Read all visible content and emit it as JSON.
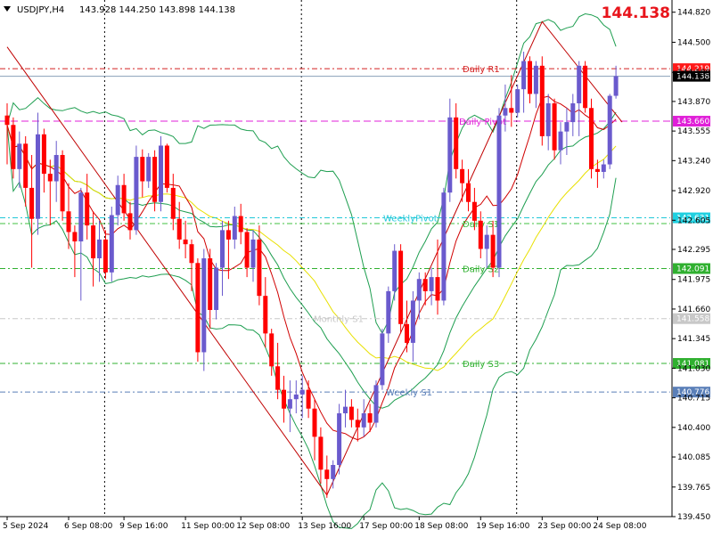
{
  "header": {
    "symbol": "USDJPY,H4",
    "ohlc": "143.928 144.250 143.898 144.138",
    "last_price": "144.138",
    "colors": {
      "last_price": "#e8141b"
    }
  },
  "chart_data": {
    "type": "candlestick",
    "title": "USDJPY,H4",
    "ylim": [
      139.45,
      144.95
    ],
    "y_ticks": [
      "144.820",
      "144.500",
      "144.180",
      "143.870",
      "143.555",
      "143.240",
      "142.920",
      "142.605",
      "142.295",
      "141.975",
      "141.660",
      "141.345",
      "141.030",
      "140.715",
      "140.400",
      "140.085",
      "139.765",
      "139.450"
    ],
    "x_ticks": [
      "5 Sep 2024",
      "6 Sep 08:00",
      "9 Sep 16:00",
      "11 Sep 00:00",
      "12 Sep 08:00",
      "13 Sep 16:00",
      "17 Sep 00:00",
      "18 Sep 08:00",
      "19 Sep 16:00",
      "23 Sep 00:00",
      "24 Sep 08:00"
    ],
    "grid": false,
    "candles": [
      [
        143.72,
        143.85,
        143.2,
        143.62
      ],
      [
        143.62,
        143.7,
        143.05,
        143.15
      ],
      [
        143.15,
        143.55,
        142.95,
        143.42
      ],
      [
        143.42,
        143.5,
        142.75,
        142.95
      ],
      [
        142.95,
        143.3,
        142.1,
        142.62
      ],
      [
        142.62,
        143.75,
        142.45,
        143.52
      ],
      [
        143.52,
        143.58,
        142.9,
        143.1
      ],
      [
        143.1,
        143.25,
        142.55,
        143.02
      ],
      [
        143.02,
        143.45,
        142.8,
        143.3
      ],
      [
        143.3,
        143.35,
        142.6,
        142.7
      ],
      [
        142.7,
        143.0,
        142.3,
        142.48
      ],
      [
        142.48,
        142.55,
        142.0,
        142.38
      ],
      [
        142.38,
        142.95,
        141.75,
        142.9
      ],
      [
        142.9,
        143.1,
        142.4,
        142.55
      ],
      [
        142.55,
        142.7,
        141.9,
        142.2
      ],
      [
        142.2,
        142.6,
        141.95,
        142.4
      ],
      [
        142.4,
        142.5,
        141.98,
        142.05
      ],
      [
        142.05,
        142.75,
        141.95,
        142.66
      ],
      [
        142.66,
        143.08,
        142.55,
        142.98
      ],
      [
        142.98,
        143.1,
        142.6,
        142.68
      ],
      [
        142.68,
        142.8,
        142.4,
        142.5
      ],
      [
        142.5,
        143.4,
        142.45,
        143.28
      ],
      [
        143.28,
        143.36,
        142.85,
        143.02
      ],
      [
        143.02,
        143.32,
        142.95,
        143.28
      ],
      [
        143.28,
        143.35,
        142.7,
        142.8
      ],
      [
        142.8,
        143.5,
        142.7,
        143.4
      ],
      [
        143.4,
        143.42,
        142.9,
        142.95
      ],
      [
        142.95,
        143.1,
        142.5,
        142.62
      ],
      [
        142.62,
        142.8,
        142.3,
        142.4
      ],
      [
        142.4,
        142.6,
        142.2,
        142.35
      ],
      [
        142.35,
        142.4,
        141.85,
        142.15
      ],
      [
        142.15,
        142.2,
        141.1,
        141.2
      ],
      [
        141.2,
        142.3,
        141.0,
        142.2
      ],
      [
        142.2,
        142.3,
        141.45,
        141.65
      ],
      [
        141.65,
        142.15,
        141.55,
        142.1
      ],
      [
        142.1,
        142.6,
        141.8,
        142.5
      ],
      [
        142.5,
        142.6,
        141.98,
        142.4
      ],
      [
        142.4,
        142.75,
        142.3,
        142.65
      ],
      [
        142.65,
        142.78,
        142.35,
        142.48
      ],
      [
        142.48,
        142.52,
        142.0,
        142.1
      ],
      [
        142.1,
        142.5,
        141.95,
        142.4
      ],
      [
        142.4,
        142.55,
        141.7,
        141.8
      ],
      [
        141.8,
        142.0,
        141.25,
        141.4
      ],
      [
        141.4,
        141.45,
        140.95,
        141.05
      ],
      [
        141.05,
        141.3,
        140.7,
        140.8
      ],
      [
        140.8,
        140.95,
        140.45,
        140.6
      ],
      [
        140.6,
        140.9,
        140.35,
        140.7
      ],
      [
        140.7,
        140.9,
        140.55,
        140.75
      ],
      [
        140.75,
        140.95,
        140.5,
        140.8
      ],
      [
        140.8,
        140.9,
        140.5,
        140.6
      ],
      [
        140.6,
        140.7,
        140.05,
        140.3
      ],
      [
        140.3,
        140.4,
        139.8,
        139.95
      ],
      [
        139.95,
        140.1,
        139.65,
        139.85
      ],
      [
        139.85,
        140.05,
        139.75,
        140.0
      ],
      [
        140.0,
        140.65,
        139.9,
        140.55
      ],
      [
        140.55,
        140.8,
        140.4,
        140.62
      ],
      [
        140.62,
        140.7,
        140.4,
        140.48
      ],
      [
        140.48,
        140.6,
        140.25,
        140.4
      ],
      [
        140.4,
        140.7,
        140.3,
        140.55
      ],
      [
        140.55,
        140.65,
        140.35,
        140.45
      ],
      [
        140.45,
        140.9,
        140.4,
        140.85
      ],
      [
        140.85,
        141.45,
        140.8,
        141.4
      ],
      [
        141.4,
        141.9,
        141.3,
        141.85
      ],
      [
        141.85,
        142.35,
        141.75,
        142.28
      ],
      [
        142.28,
        142.35,
        141.4,
        141.5
      ],
      [
        141.5,
        141.75,
        141.2,
        141.3
      ],
      [
        141.3,
        141.85,
        141.1,
        141.75
      ],
      [
        141.75,
        142.05,
        141.55,
        141.98
      ],
      [
        141.98,
        142.05,
        141.7,
        141.85
      ],
      [
        141.85,
        142.1,
        141.7,
        142.0
      ],
      [
        142.0,
        142.4,
        141.6,
        141.75
      ],
      [
        141.75,
        142.95,
        141.7,
        142.9
      ],
      [
        142.9,
        143.9,
        142.8,
        143.7
      ],
      [
        143.7,
        143.85,
        143.05,
        143.15
      ],
      [
        143.15,
        143.25,
        142.8,
        143.0
      ],
      [
        143.0,
        143.15,
        142.7,
        142.8
      ],
      [
        142.8,
        142.95,
        142.5,
        142.6
      ],
      [
        142.6,
        142.7,
        142.2,
        142.3
      ],
      [
        142.3,
        142.55,
        142.1,
        142.45
      ],
      [
        142.45,
        142.6,
        142.0,
        142.1
      ],
      [
        142.1,
        143.8,
        142.0,
        143.72
      ],
      [
        143.72,
        144.05,
        143.55,
        143.8
      ],
      [
        143.8,
        144.15,
        143.6,
        143.75
      ],
      [
        143.75,
        144.05,
        143.7,
        144.0
      ],
      [
        144.0,
        144.4,
        143.75,
        144.3
      ],
      [
        144.3,
        144.35,
        143.85,
        143.95
      ],
      [
        143.95,
        144.3,
        143.8,
        144.25
      ],
      [
        144.25,
        144.35,
        143.4,
        143.5
      ],
      [
        143.5,
        143.95,
        143.35,
        143.85
      ],
      [
        143.85,
        143.9,
        143.25,
        143.35
      ],
      [
        143.35,
        143.65,
        143.2,
        143.55
      ],
      [
        143.55,
        143.8,
        143.3,
        143.65
      ],
      [
        143.65,
        143.95,
        143.5,
        143.85
      ],
      [
        143.85,
        144.3,
        143.5,
        144.25
      ],
      [
        144.25,
        144.3,
        143.75,
        143.8
      ],
      [
        143.8,
        143.9,
        143.05,
        143.15
      ],
      [
        143.15,
        143.25,
        142.95,
        143.12
      ],
      [
        143.12,
        143.25,
        143.05,
        143.2
      ],
      [
        143.2,
        143.95,
        143.15,
        143.93
      ],
      [
        143.93,
        144.25,
        143.9,
        144.14
      ]
    ],
    "levels": [
      {
        "name": "Daily R1",
        "value": 144.219,
        "color": "#d42020",
        "dash": "6,3,2,3",
        "tag": true,
        "tag_color": "#ff1a1a",
        "label": "Daily R1"
      },
      {
        "name": "Daily Pivot",
        "value": 143.66,
        "color": "#e020d8",
        "dash": "8,4",
        "tag": true,
        "tag_color": "#e020d8",
        "label": "Daily Pivot"
      },
      {
        "name": "Weekly Pivot",
        "value": 142.631,
        "color": "#20c8d8",
        "dash": "6,3,2,3",
        "tag": true,
        "tag_color": "#20d0e0",
        "label": "WeeklyPivot"
      },
      {
        "name": "Daily S1",
        "value": 142.57,
        "color": "#40c040",
        "dash": "6,3,2,3",
        "tag": false,
        "label": "Daily S1"
      },
      {
        "name": "Daily S2",
        "value": 142.091,
        "color": "#30b030",
        "dash": "6,3,2,3",
        "tag": true,
        "tag_color": "#30b030",
        "label": "Daily S2"
      },
      {
        "name": "Monthly S1",
        "value": 141.558,
        "color": "#c8c8c8",
        "dash": "6,3,2,3",
        "tag": true,
        "tag_color": "#c8c8c8",
        "label": "Monthly S1"
      },
      {
        "name": "Daily S3",
        "value": 141.081,
        "color": "#30b030",
        "dash": "6,3,2,3",
        "tag": true,
        "tag_color": "#30b030",
        "label": "Daily S3"
      },
      {
        "name": "Weekly S1",
        "value": 140.776,
        "color": "#5a7fb8",
        "dash": "6,3,2,3",
        "tag": true,
        "tag_color": "#5a7fb8",
        "label": "Weekly S1"
      }
    ],
    "bid_line": {
      "value": 144.138,
      "color": "#8aa0b8"
    },
    "zigzag": [
      [
        0,
        144.45
      ],
      [
        52,
        139.68
      ],
      [
        87,
        144.72
      ],
      [
        100,
        143.65
      ]
    ],
    "zigzag_color": "#c00000",
    "bands_color": "#1e9e50",
    "ma_slow_color": "#e8e000",
    "ma_fast_color": "#d00000",
    "colors": {
      "bull": "#6a5acd",
      "bear": "#ff0000"
    }
  }
}
